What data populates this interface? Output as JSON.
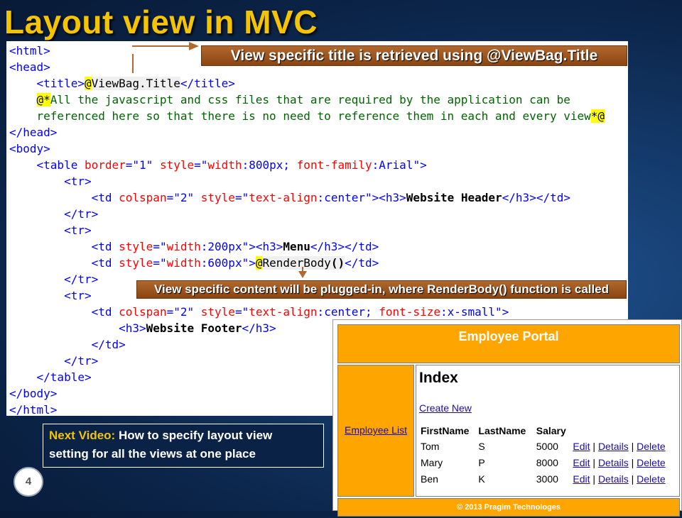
{
  "slide": {
    "title": "Layout view in MVC",
    "page_number": "4"
  },
  "code_lines": [
    "<html>",
    "<head>",
    "    <title>@ViewBag.Title</title>",
    "    @*All the javascript and css files that are required by the application can be",
    "    referenced here so that there is no need to reference them in each and every view*@",
    "</head>",
    "<body>",
    "    <table border=\"1\" style=\"width:800px; font-family:Arial\">",
    "        <tr>",
    "            <td colspan=\"2\" style=\"text-align:center\"><h3>Website Header</h3></td>",
    "        </tr>",
    "        <tr>",
    "            <td style=\"width:200px\"><h3>Menu</h3></td>",
    "            <td style=\"width:600px\">@RenderBody()</td>",
    "        </tr>",
    "        <tr>",
    "            <td colspan=\"2\" style=\"text-align:center; font-size:x-small\">",
    "                <h3>Website Footer</h3>",
    "            </td>",
    "        </tr>",
    "    </table>",
    "</body>",
    "</html>"
  ],
  "callouts": {
    "title_callout": "View specific title is retrieved using @ViewBag.Title",
    "body_callout": "View specific content will be plugged-in, where RenderBody() function is called"
  },
  "next_video": {
    "label": "Next Video:",
    "text_line1": "How to specify layout view",
    "text_line2": "setting for all the views at one place"
  },
  "browser_preview": {
    "header": "Employee Portal",
    "menu_link": "Employee List",
    "page_heading": "Index",
    "create_link": "Create New",
    "columns": [
      "FirstName",
      "LastName",
      "Salary"
    ],
    "rows": [
      {
        "first": "Tom",
        "last": "S",
        "salary": "5000"
      },
      {
        "first": "Mary",
        "last": "P",
        "salary": "8000"
      },
      {
        "first": "Ben",
        "last": "K",
        "salary": "3000"
      }
    ],
    "row_actions": [
      "Edit",
      "Details",
      "Delete"
    ],
    "action_separator": "|",
    "footer": "© 2013 Pragim Technologes"
  },
  "colors": {
    "title_yellow": "#f5c400",
    "callout_brown": "#8b4513",
    "portal_orange": "#ffa500",
    "slide_background": "#143a6b"
  }
}
